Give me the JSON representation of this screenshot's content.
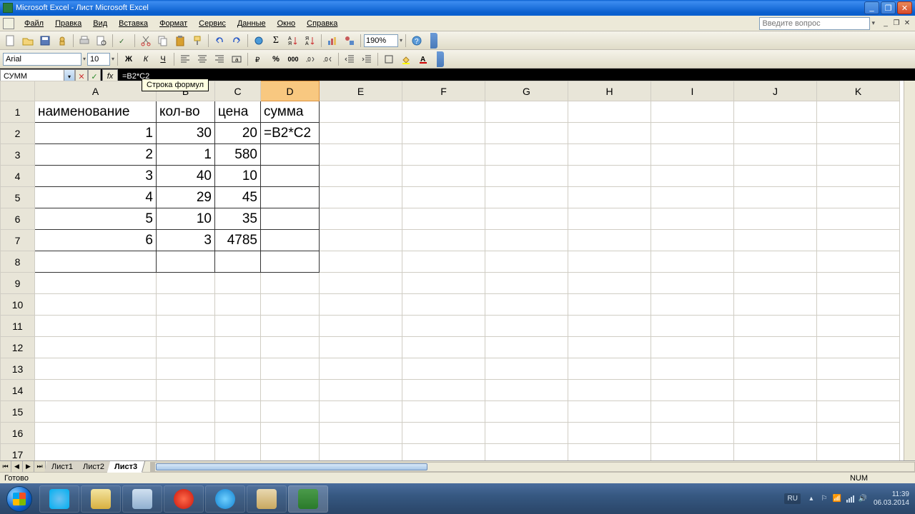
{
  "window": {
    "title": "Microsoft Excel - Лист Microsoft Excel"
  },
  "menu": {
    "file": "Файл",
    "edit": "Правка",
    "view": "Вид",
    "insert": "Вставка",
    "format": "Формат",
    "tools": "Сервис",
    "data": "Данные",
    "window": "Окно",
    "help": "Справка"
  },
  "help_search": {
    "placeholder": "Введите вопрос"
  },
  "toolbar": {
    "zoom": "190%"
  },
  "format_bar": {
    "font_name": "Arial",
    "font_size": "10"
  },
  "formula": {
    "name_box": "СУММ",
    "content": "=B2*C2",
    "tooltip": "Строка формул"
  },
  "columns": [
    "A",
    "B",
    "C",
    "D",
    "E",
    "F",
    "G",
    "H",
    "I",
    "J",
    "K"
  ],
  "selected_col": "D",
  "headers": {
    "A": "наименование",
    "B": "кол-во",
    "C": "цена",
    "D": "сумма"
  },
  "rows": [
    {
      "n": "1",
      "A": "наименование",
      "B": "кол-во",
      "C": "цена",
      "D": "сумма",
      "is_header": true
    },
    {
      "n": "2",
      "A": "1",
      "B": "30",
      "C": "20",
      "D": "=B2*C2",
      "editing": true
    },
    {
      "n": "3",
      "A": "2",
      "B": "1",
      "C": "580",
      "D": ""
    },
    {
      "n": "4",
      "A": "3",
      "B": "40",
      "C": "10",
      "D": ""
    },
    {
      "n": "5",
      "A": "4",
      "B": "29",
      "C": "45",
      "D": ""
    },
    {
      "n": "6",
      "A": "5",
      "B": "10",
      "C": "35",
      "D": ""
    },
    {
      "n": "7",
      "A": "6",
      "B": "3",
      "C": "4785",
      "D": ""
    },
    {
      "n": "8",
      "A": "",
      "B": "",
      "C": "",
      "D": ""
    },
    {
      "n": "9"
    },
    {
      "n": "10"
    },
    {
      "n": "11"
    },
    {
      "n": "12"
    },
    {
      "n": "13"
    },
    {
      "n": "14"
    },
    {
      "n": "15"
    },
    {
      "n": "16"
    },
    {
      "n": "17"
    }
  ],
  "sheets": {
    "tabs": [
      "Лист1",
      "Лист2",
      "Лист3"
    ],
    "active": "Лист3"
  },
  "status": {
    "ready": "Готово",
    "num": "NUM"
  },
  "taskbar": {
    "lang": "RU",
    "time": "11:39",
    "date": "06.03.2014"
  }
}
